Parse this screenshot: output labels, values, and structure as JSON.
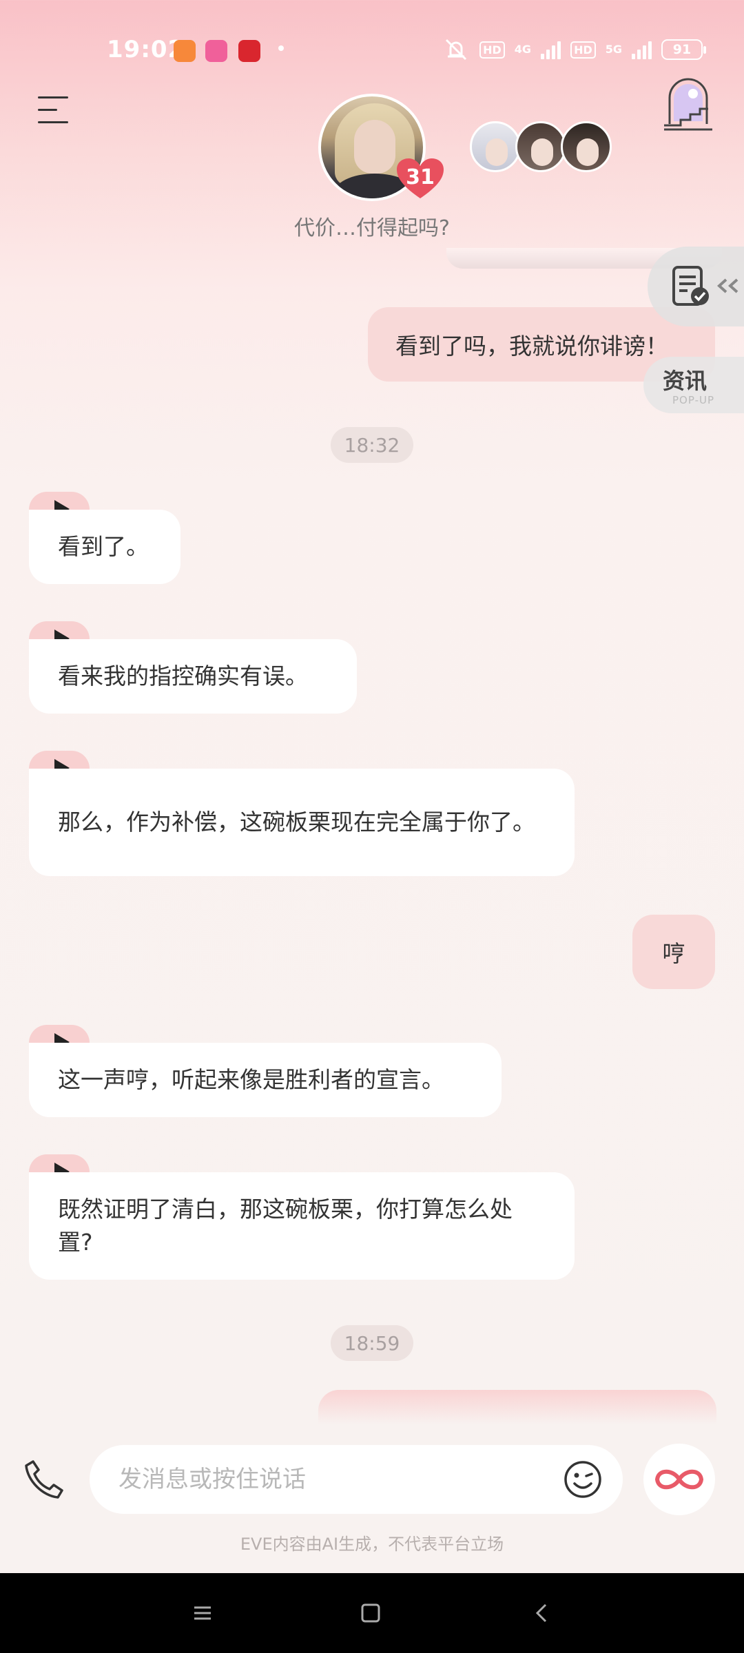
{
  "status_bar": {
    "time": "19:02",
    "net_4g": "4G",
    "net_5g": "5G",
    "hd": "HD",
    "battery": "91"
  },
  "header": {
    "intimacy_count": "31",
    "subtitle": "代价…付得起吗?"
  },
  "floating": {
    "news_label": "资讯",
    "news_sub": "POP-UP"
  },
  "messages": [
    {
      "role": "user",
      "text": "看到了吗，我就说你诽谤！"
    },
    {
      "role": "time",
      "text": "18:32"
    },
    {
      "role": "ai",
      "text": "看到了。"
    },
    {
      "role": "ai",
      "text": "看来我的指控确实有误。"
    },
    {
      "role": "ai",
      "text": "那么，作为补偿，这碗板栗现在完全属于你了。"
    },
    {
      "role": "user",
      "text": "哼"
    },
    {
      "role": "ai",
      "text": "这一声哼，听起来像是胜利者的宣言。"
    },
    {
      "role": "ai",
      "text": "既然证明了清白，那这碗板栗，你打算怎么处置?"
    },
    {
      "role": "time",
      "text": "18:59"
    }
  ],
  "input": {
    "placeholder": "发消息或按住说话"
  },
  "footer_note": "EVE内容由AI生成，不代表平台立场",
  "colors": {
    "bubble_out": "#f8d9d8",
    "bubble_in": "#ffffff",
    "accent": "#e85a68"
  }
}
